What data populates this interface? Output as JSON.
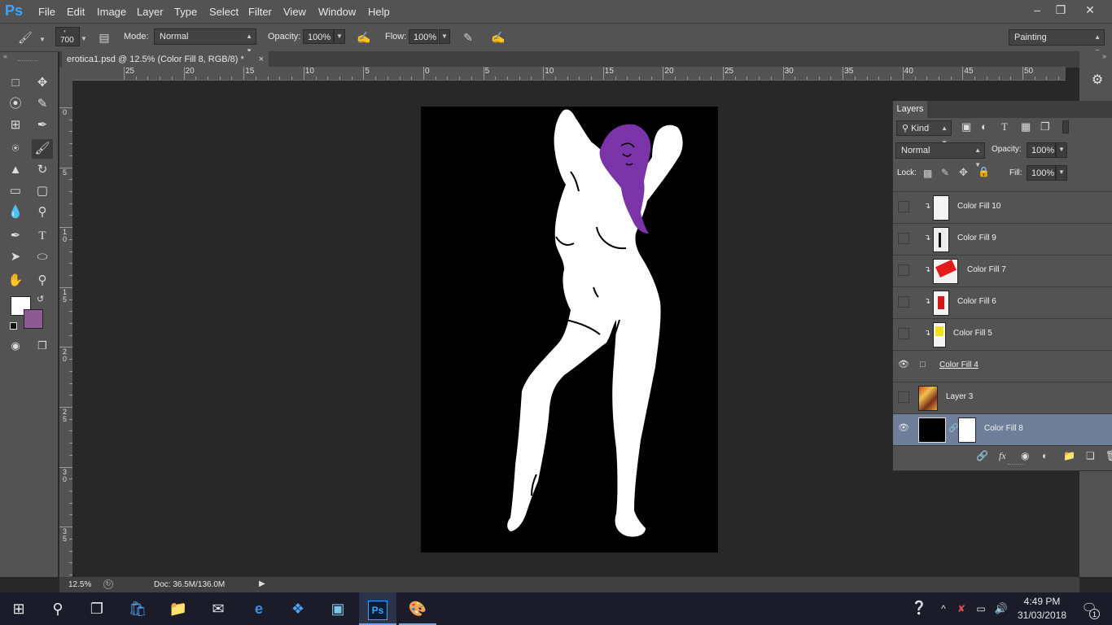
{
  "app": {
    "logo": "Ps"
  },
  "menu": [
    "File",
    "Edit",
    "Image",
    "Layer",
    "Type",
    "Select",
    "Filter",
    "View",
    "Window",
    "Help"
  ],
  "window_buttons": {
    "minimize": "minimize-icon",
    "restore": "restore-icon",
    "close": "close-icon"
  },
  "options_bar": {
    "brush_size": "700",
    "mode_label": "Mode:",
    "mode_value": "Normal",
    "opacity_label": "Opacity:",
    "opacity_value": "100%",
    "flow_label": "Flow:",
    "flow_value": "100%",
    "workspace": "Painting"
  },
  "document": {
    "tab_title": "erotica1.psd @ 12.5% (Color Fill 8, RGB/8) *",
    "close_glyph": "×",
    "zoom": "12.5%",
    "doc_info": "Doc: 36.5M/136.0M"
  },
  "rulers": {
    "horizontal": [
      "25",
      "20",
      "15",
      "10",
      "5",
      "0",
      "5",
      "10",
      "15",
      "20",
      "25",
      "30",
      "35",
      "40",
      "45",
      "50"
    ],
    "vertical": [
      "0",
      "5",
      "1\n0",
      "1\n5",
      "2\n0",
      "2\n5",
      "3\n0",
      "3\n5"
    ]
  },
  "colors": {
    "foreground": "#ffffff",
    "background": "#8e5a94",
    "hair": "#7b33a8",
    "selection": "#6f7f99"
  },
  "layers_panel": {
    "tab": "Layers",
    "filter_kind": "Kind",
    "blend_mode": "Normal",
    "opacity_label": "Opacity:",
    "opacity_value": "100%",
    "lock_label": "Lock:",
    "fill_label": "Fill:",
    "fill_value": "100%",
    "layers": [
      {
        "name": "Color Fill 10",
        "visible": false,
        "clipped": true,
        "thumb": "white-figure"
      },
      {
        "name": "Color Fill 9",
        "visible": false,
        "clipped": true,
        "thumb": "black-figure"
      },
      {
        "name": "Color Fill 7",
        "visible": false,
        "clipped": true,
        "thumb": "red-figure"
      },
      {
        "name": "Color Fill 6",
        "visible": false,
        "clipped": true,
        "thumb": "red-small"
      },
      {
        "name": "Color Fill 5",
        "visible": false,
        "clipped": true,
        "thumb": "yellow"
      },
      {
        "name": "Color Fill 4",
        "visible": true,
        "clipped": false,
        "thumb": "shape"
      },
      {
        "name": "Layer 3",
        "visible": false,
        "clipped": false,
        "thumb": "artwork"
      },
      {
        "name": "Color Fill 8",
        "visible": true,
        "clipped": false,
        "thumb": "black-fill",
        "selected": true
      }
    ]
  },
  "taskbar": {
    "time": "4:49 PM",
    "date": "31/03/2018",
    "notification_count": "1"
  }
}
